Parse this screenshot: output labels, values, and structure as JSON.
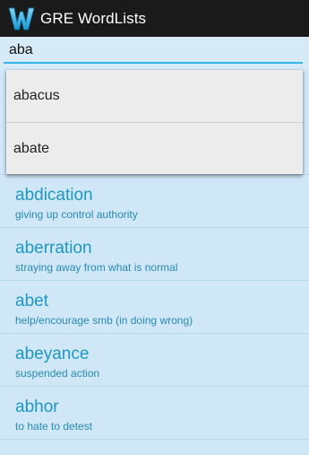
{
  "app": {
    "title": "GRE WordLists",
    "logo_icon": "w-logo-icon",
    "brand_color": "#33b5e5"
  },
  "search": {
    "value": "aba"
  },
  "suggestions": [
    {
      "label": "abacus"
    },
    {
      "label": "abate"
    }
  ],
  "words": [
    {
      "word": "abdication",
      "definition": "giving up control authority"
    },
    {
      "word": "aberration",
      "definition": "straying away from what is normal"
    },
    {
      "word": "abet",
      "definition": "help/encourage smb (in doing wrong)"
    },
    {
      "word": "abeyance",
      "definition": "suspended action"
    },
    {
      "word": "abhor",
      "definition": "to hate to detest"
    }
  ]
}
